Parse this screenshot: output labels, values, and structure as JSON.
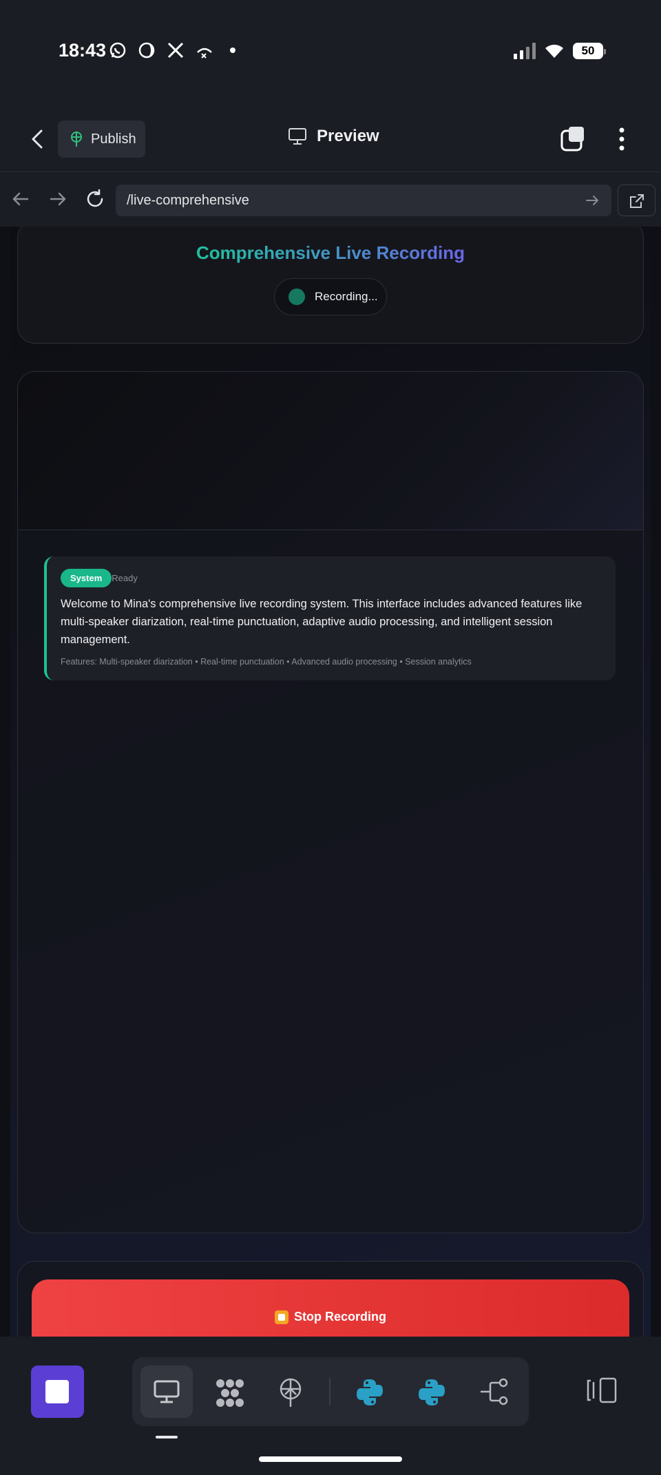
{
  "status_bar": {
    "time": "18:43",
    "battery": "50",
    "left_icons": [
      "whatsapp-icon",
      "moon-icon",
      "x-icon",
      "call-icon"
    ],
    "right_icons": [
      "signal-icon",
      "wifi-icon",
      "battery-icon"
    ]
  },
  "app_header": {
    "publish_label": "Publish",
    "preview_label": "Preview"
  },
  "url_bar": {
    "url": "/live-comprehensive"
  },
  "page": {
    "title": "Comprehensive Live Recording",
    "recording_status": "Recording...",
    "message": {
      "badge": "System",
      "status": "Ready",
      "body": "Welcome to Mina's comprehensive live recording system. This interface includes advanced features like multi-speaker diarization, real-time punctuation, adaptive audio processing, and intelligent session management.",
      "features": "Features: Multi-speaker diarization • Real-time punctuation • Advanced audio processing • Session analytics"
    },
    "stop_button_label": "Stop Recording"
  },
  "dock": {
    "tools": [
      "desktop-icon",
      "grid-icon",
      "deploy-icon",
      "python-icon",
      "python-icon",
      "git-branch-icon"
    ]
  },
  "colors": {
    "accent_green": "#19b78a",
    "stop_red": "#ef4242",
    "stop_app_purple": "#5b3fd4",
    "title_gradient_start": "#1ec3a0",
    "title_gradient_end": "#6b66e8"
  }
}
